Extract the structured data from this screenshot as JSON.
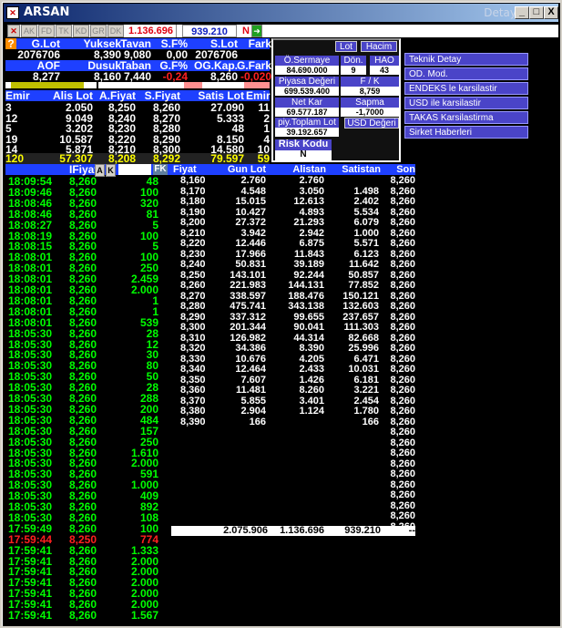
{
  "title": {
    "text": "ARSAN",
    "right": "Detay",
    "min": "_",
    "max": "□",
    "close": "X"
  },
  "toolbar": {
    "btns": [
      "AK",
      "FD",
      "TK",
      "KD",
      "GR",
      "DK"
    ],
    "value1": "1.136.696",
    "value2": "939.210",
    "n": "N"
  },
  "info": {
    "h1": [
      "G.Lot",
      "Yuksek",
      "Tavan",
      "S.F%",
      "S.Lot",
      "Fark"
    ],
    "v1": [
      "2076706",
      "8,390",
      "9,080",
      "0,00",
      "2076706",
      ""
    ],
    "h2": [
      "AOF",
      "Dusuk",
      "Taban",
      "G.F%",
      "OG.Kap.",
      "G.Fark"
    ],
    "v2": [
      "8,277",
      "8,160",
      "7,440",
      "-0,24",
      "8,260",
      "-0,020"
    ]
  },
  "depth": {
    "headers": [
      "Emir",
      "Alis Lot",
      "A.Fiyat",
      "S.Fiyat",
      "Satis Lot",
      "Emir"
    ],
    "rows": [
      [
        "3",
        "2.050",
        "8,250",
        "8,260",
        "27.090",
        "11"
      ],
      [
        "12",
        "9.049",
        "8,240",
        "8,270",
        "5.333",
        "2"
      ],
      [
        "5",
        "3.202",
        "8,230",
        "8,280",
        "48",
        "1"
      ],
      [
        "19",
        "10.587",
        "8,220",
        "8,290",
        "8.150",
        "4"
      ],
      [
        "14",
        "5.871",
        "8,210",
        "8,300",
        "14.580",
        "10"
      ]
    ],
    "total": [
      "120",
      "57.307",
      "8,208",
      "8,292",
      "79.597",
      "59"
    ]
  },
  "panel": {
    "lot": "Lot",
    "hacim": "Hacim",
    "osermaye_l": "Ö.Sermaye",
    "osermaye_v": "84.690.000",
    "don_l": "Dön.",
    "don_v": "9",
    "hao_l": "HAO",
    "hao_v": "43",
    "piyasa_l": "Piyasa Değeri",
    "piyasa_v": "699.539.400",
    "fk_l": "F / K",
    "fk_v": "8,759",
    "netkar_l": "Net Kar",
    "netkar_v": "69.577.187",
    "sapma_l": "Sapma",
    "sapma_v": "-1,7000",
    "piy_l": "piy.Toplam Lot",
    "piy_v": "39.192.657",
    "usd_l": "USD Değeri",
    "risk_l": "Risk Kodu",
    "risk_v": "N"
  },
  "menu": [
    "Teknik Detay",
    "OD. Mod.",
    "ENDEKS le karsilastir",
    "USD ile karsilastir",
    "TAKAS Karsilastirma",
    "Sirket Haberleri"
  ],
  "trades_hdr": {
    "fiyat": "IFiyat",
    "a": "A",
    "k": "K",
    "fk": "FK"
  },
  "trades": [
    [
      "18:09:54",
      "8,260",
      "48",
      "g"
    ],
    [
      "18:09:46",
      "8,260",
      "100",
      "g"
    ],
    [
      "18:08:46",
      "8,260",
      "320",
      "g"
    ],
    [
      "18:08:46",
      "8,260",
      "81",
      "g"
    ],
    [
      "18:08:27",
      "8,260",
      "5",
      "g"
    ],
    [
      "18:08:19",
      "8,260",
      "100",
      "g"
    ],
    [
      "18:08:15",
      "8,260",
      "5",
      "g"
    ],
    [
      "18:08:01",
      "8,260",
      "100",
      "g"
    ],
    [
      "18:08:01",
      "8,260",
      "250",
      "g"
    ],
    [
      "18:08:01",
      "8,260",
      "2.459",
      "g"
    ],
    [
      "18:08:01",
      "8,260",
      "2.000",
      "g"
    ],
    [
      "18:08:01",
      "8,260",
      "1",
      "g"
    ],
    [
      "18:08:01",
      "8,260",
      "1",
      "g"
    ],
    [
      "18:08:01",
      "8,260",
      "539",
      "g"
    ],
    [
      "18:05:30",
      "8,260",
      "28",
      "g"
    ],
    [
      "18:05:30",
      "8,260",
      "12",
      "g"
    ],
    [
      "18:05:30",
      "8,260",
      "30",
      "g"
    ],
    [
      "18:05:30",
      "8,260",
      "80",
      "g"
    ],
    [
      "18:05:30",
      "8,260",
      "50",
      "g"
    ],
    [
      "18:05:30",
      "8,260",
      "28",
      "g"
    ],
    [
      "18:05:30",
      "8,260",
      "288",
      "g"
    ],
    [
      "18:05:30",
      "8,260",
      "200",
      "g"
    ],
    [
      "18:05:30",
      "8,260",
      "484",
      "g"
    ],
    [
      "18:05:30",
      "8,260",
      "157",
      "g"
    ],
    [
      "18:05:30",
      "8,260",
      "250",
      "g"
    ],
    [
      "18:05:30",
      "8,260",
      "1.610",
      "g"
    ],
    [
      "18:05:30",
      "8,260",
      "2.000",
      "g"
    ],
    [
      "18:05:30",
      "8,260",
      "591",
      "g"
    ],
    [
      "18:05:30",
      "8,260",
      "1.000",
      "g"
    ],
    [
      "18:05:30",
      "8,260",
      "409",
      "g"
    ],
    [
      "18:05:30",
      "8,260",
      "892",
      "g"
    ],
    [
      "18:05:30",
      "8,260",
      "108",
      "g"
    ],
    [
      "17:59:49",
      "8,260",
      "100",
      "g"
    ],
    [
      "17:59:44",
      "8,250",
      "774",
      "r"
    ],
    [
      "17:59:41",
      "8,260",
      "1.333",
      "g"
    ],
    [
      "17:59:41",
      "8,260",
      "2.000",
      "g"
    ],
    [
      "17:59:41",
      "8,260",
      "2.000",
      "g"
    ],
    [
      "17:59:41",
      "8,260",
      "2.000",
      "g"
    ],
    [
      "17:59:41",
      "8,260",
      "2.000",
      "g"
    ],
    [
      "17:59:41",
      "8,260",
      "2.000",
      "g"
    ],
    [
      "17:59:41",
      "8,260",
      "1.567",
      "g"
    ]
  ],
  "dist_hdr": [
    "Fiyat",
    "Gun Lot",
    "Alistan",
    "Satistan",
    "Son"
  ],
  "dist": [
    [
      "8,160",
      "2.760",
      "2.760",
      ""
    ],
    [
      "8,170",
      "4.548",
      "3.050",
      "1.498"
    ],
    [
      "8,180",
      "15.015",
      "12.613",
      "2.402"
    ],
    [
      "8,190",
      "10.427",
      "4.893",
      "5.534"
    ],
    [
      "8,200",
      "27.372",
      "21.293",
      "6.079"
    ],
    [
      "8,210",
      "3.942",
      "2.942",
      "1.000"
    ],
    [
      "8,220",
      "12.446",
      "6.875",
      "5.571"
    ],
    [
      "8,230",
      "17.966",
      "11.843",
      "6.123"
    ],
    [
      "8,240",
      "50.831",
      "39.189",
      "11.642"
    ],
    [
      "8,250",
      "143.101",
      "92.244",
      "50.857"
    ],
    [
      "8,260",
      "221.983",
      "144.131",
      "77.852"
    ],
    [
      "8,270",
      "338.597",
      "188.476",
      "150.121"
    ],
    [
      "8,280",
      "475.741",
      "343.138",
      "132.603"
    ],
    [
      "8,290",
      "337.312",
      "99.655",
      "237.657"
    ],
    [
      "8,300",
      "201.344",
      "90.041",
      "111.303"
    ],
    [
      "8,310",
      "126.982",
      "44.314",
      "82.668"
    ],
    [
      "8,320",
      "34.386",
      "8.390",
      "25.996"
    ],
    [
      "8,330",
      "10.676",
      "4.205",
      "6.471"
    ],
    [
      "8,340",
      "12.464",
      "2.433",
      "10.031"
    ],
    [
      "8,350",
      "7.607",
      "1.426",
      "6.181"
    ],
    [
      "8,360",
      "11.481",
      "8.260",
      "3.221"
    ],
    [
      "8,370",
      "5.855",
      "3.401",
      "2.454"
    ],
    [
      "8,380",
      "2.904",
      "1.124",
      "1.780"
    ],
    [
      "8,390",
      "166",
      "",
      "166"
    ]
  ],
  "dist_total": [
    "",
    "2.075.906",
    "1.136.696",
    "939.210",
    "--"
  ],
  "son": [
    "8,260",
    "8,260",
    "8,260",
    "8,260",
    "8,260",
    "8,260",
    "8,260",
    "8,260",
    "8,260",
    "8,260",
    "8,260",
    "8,260",
    "8,260",
    "8,260",
    "8,260",
    "8,260",
    "8,260",
    "8,260",
    "8,260",
    "8,260",
    "8,260",
    "8,260",
    "8,260",
    "8,260",
    "8,260",
    "8,260",
    "8,260",
    "8,260",
    "8,260",
    "8,260",
    "8,260",
    "8,260",
    "8,260",
    "8,260"
  ]
}
